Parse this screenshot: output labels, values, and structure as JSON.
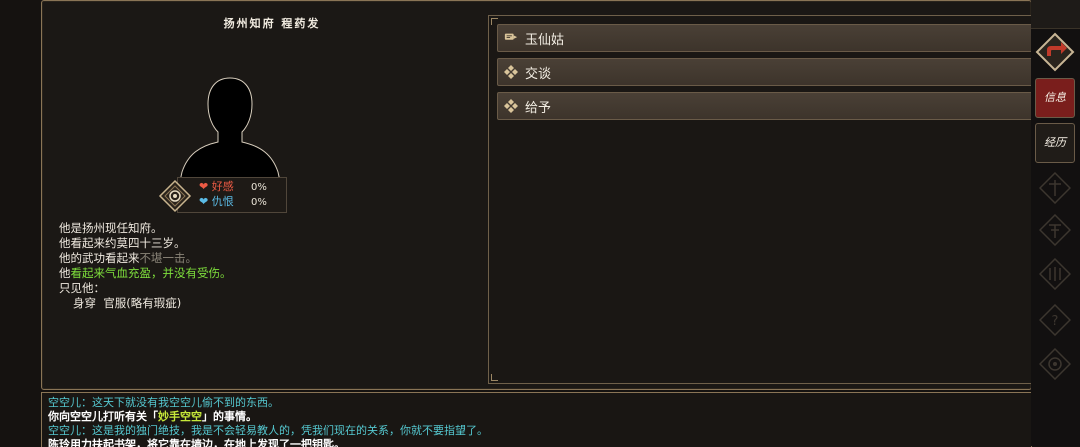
{
  "npc": {
    "title": "扬州知府  程药发",
    "relations": [
      {
        "label": "好感",
        "value": "0%",
        "color": "#ec5a44"
      },
      {
        "label": "仇恨",
        "value": "0%",
        "color": "#5bbbe6"
      }
    ],
    "desc": {
      "line1": "他是扬州现任知府。",
      "line2": "他看起来约莫四十三岁。",
      "line3_prefix": "他的武功看起来",
      "line3_rating": "不堪一击。",
      "line4_prefix": "他",
      "line4_status": "看起来气血充盈，并没有受伤。",
      "line5": "只见他：",
      "line6_wear": "身穿",
      "line6_item": "官服(略有瑕疵)"
    }
  },
  "actions": [
    {
      "label": "玉仙姑",
      "icon": "chat-bubble-icon"
    },
    {
      "label": "交谈",
      "icon": "diamond-cluster-icon"
    },
    {
      "label": "给予",
      "icon": "diamond-cluster-icon"
    }
  ],
  "log": {
    "l1": "空空儿：这天下就没有我空空儿偷不到的东西。",
    "l2_a": "你向空空儿打听有关「",
    "l2_b": "妙手空空",
    "l2_c": "」的事情。",
    "l3": "空空儿：这是我的独门绝技，我是不会轻易教人的，凭我们现在的关系，你就不要指望了。",
    "l4": "陈玲用力扶起书架，将它靠在墙边，在地上发现了一把钥匙。"
  },
  "sidebar": {
    "info_label": "信息",
    "history_label": "经历"
  },
  "colors": {
    "accent": "#8a7556",
    "button_bg": "#4a4036",
    "active_tab": "#7a1e1c",
    "cyan_text": "#55c8d0",
    "green_text": "#7ede3c"
  }
}
